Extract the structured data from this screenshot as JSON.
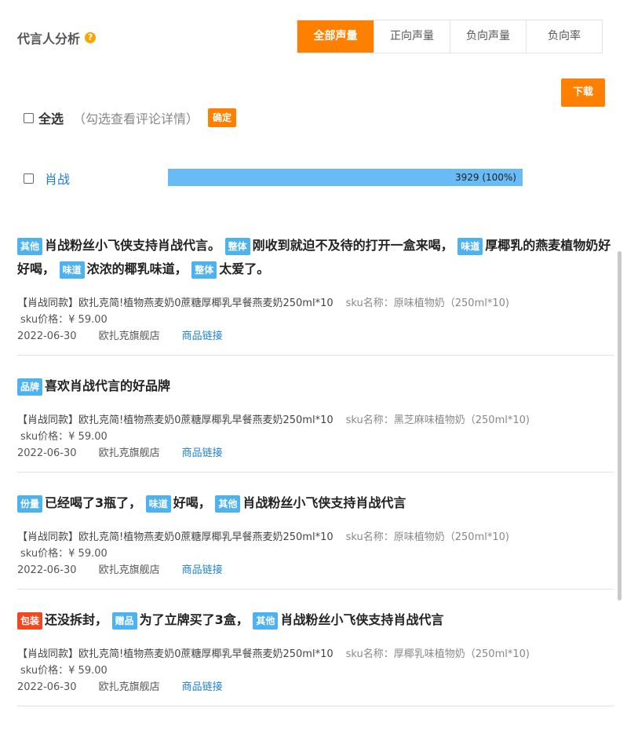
{
  "header": {
    "title": "代言人分析",
    "help_glyph": "?"
  },
  "tabs": [
    {
      "label": "全部声量",
      "active": true
    },
    {
      "label": "正向声量",
      "active": false
    },
    {
      "label": "负向声量",
      "active": false
    },
    {
      "label": "负向率",
      "active": false
    }
  ],
  "toolbar": {
    "download_label": "下载"
  },
  "selection": {
    "select_all_label": "全选",
    "hint": "（勾选查看评论详情）",
    "confirm_label": "确定"
  },
  "spokesperson": {
    "name": "肖战",
    "bar_label": "3929 (100%)",
    "share": 1.0
  },
  "colors": {
    "accent": "#ff8000",
    "bar": "#68bbf5",
    "tag_blue": "#4db3f0",
    "tag_red": "#f24822",
    "link": "#1e7fd4"
  },
  "comments": [
    {
      "segments": [
        {
          "tag": "其他",
          "tag_color": "#4db3f0",
          "text": "肖战粉丝小飞侠支持肖战代言。"
        },
        {
          "tag": "整体",
          "tag_color": "#4db3f0",
          "text": "刚收到就迫不及待的打开一盒来喝，"
        },
        {
          "tag": "味道",
          "tag_color": "#4db3f0",
          "text": "厚椰乳的燕麦植物奶好好喝，"
        },
        {
          "tag": "味道",
          "tag_color": "#4db3f0",
          "text": "浓浓的椰乳味道，"
        },
        {
          "tag": "整体",
          "tag_color": "#4db3f0",
          "text": "太爱了。"
        }
      ],
      "product": "【肖战同款】欧扎克简!植物燕麦奶0蔗糖厚椰乳早餐燕麦奶250ml*10",
      "sku_name": "sku名称：原味植物奶（250ml*10)",
      "sku_price": "sku价格：¥ 59.00",
      "date": "2022-06-30",
      "shop": "欧扎克旗舰店",
      "link_label": "商品链接"
    },
    {
      "segments": [
        {
          "tag": "品牌",
          "tag_color": "#4db3f0",
          "text": "喜欢肖战代言的好品牌"
        }
      ],
      "product": "【肖战同款】欧扎克简!植物燕麦奶0蔗糖厚椰乳早餐燕麦奶250ml*10",
      "sku_name": "sku名称：黑芝麻味植物奶（250ml*10)",
      "sku_price": "sku价格：¥ 59.00",
      "date": "2022-06-30",
      "shop": "欧扎克旗舰店",
      "link_label": "商品链接"
    },
    {
      "segments": [
        {
          "tag": "份量",
          "tag_color": "#4db3f0",
          "text": "已经喝了3瓶了，"
        },
        {
          "tag": "味道",
          "tag_color": "#4db3f0",
          "text": "好喝，"
        },
        {
          "tag": "其他",
          "tag_color": "#4db3f0",
          "text": "肖战粉丝小飞侠支持肖战代言"
        }
      ],
      "product": "【肖战同款】欧扎克简!植物燕麦奶0蔗糖厚椰乳早餐燕麦奶250ml*10",
      "sku_name": "sku名称：原味植物奶（250ml*10)",
      "sku_price": "sku价格：¥ 59.00",
      "date": "2022-06-30",
      "shop": "欧扎克旗舰店",
      "link_label": "商品链接"
    },
    {
      "segments": [
        {
          "tag": "包装",
          "tag_color": "#f24822",
          "text": "还没拆封，"
        },
        {
          "tag": "赠品",
          "tag_color": "#4db3f0",
          "text": "为了立牌买了3盒，"
        },
        {
          "tag": "其他",
          "tag_color": "#4db3f0",
          "text": "肖战粉丝小飞侠支持肖战代言"
        }
      ],
      "product": "【肖战同款】欧扎克简!植物燕麦奶0蔗糖厚椰乳早餐燕麦奶250ml*10",
      "sku_name": "sku名称：厚椰乳味植物奶（250ml*10)",
      "sku_price": "sku价格：¥ 59.00",
      "date": "2022-06-30",
      "shop": "欧扎克旗舰店",
      "link_label": "商品链接"
    }
  ]
}
